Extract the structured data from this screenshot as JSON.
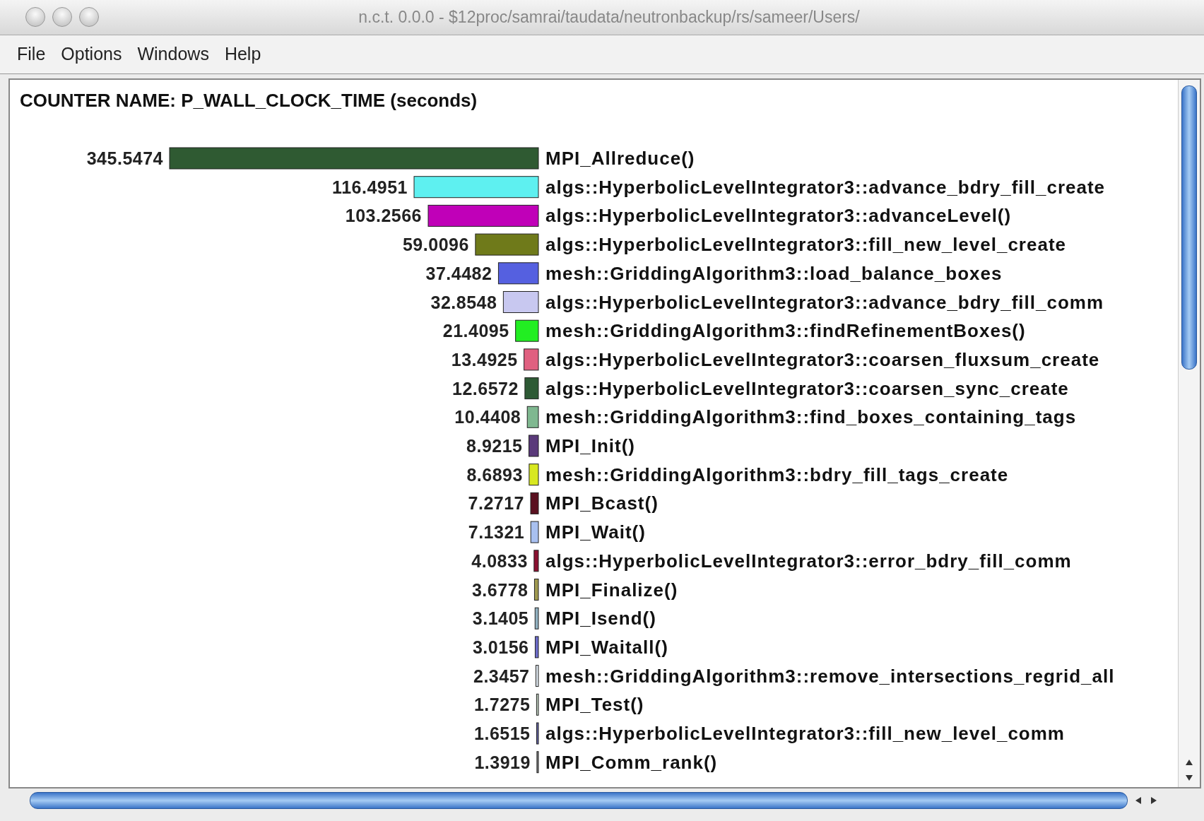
{
  "window": {
    "title": "n.c.t. 0.0.0 - $12proc/samrai/taudata/neutronbackup/rs/sameer/Users/"
  },
  "menu": [
    "File",
    "Options",
    "Windows",
    "Help"
  ],
  "chart": {
    "chart_data": {
      "type": "bar",
      "orientation": "horizontal",
      "title": "COUNTER NAME: P_WALL_CLOCK_TIME (seconds)",
      "data_labels": true,
      "categories": [
        "MPI_Allreduce()",
        "algs::HyperbolicLevelIntegrator3::advance_bdry_fill_create",
        "algs::HyperbolicLevelIntegrator3::advanceLevel()",
        "algs::HyperbolicLevelIntegrator3::fill_new_level_create",
        "mesh::GriddingAlgorithm3::load_balance_boxes",
        "algs::HyperbolicLevelIntegrator3::advance_bdry_fill_comm",
        "mesh::GriddingAlgorithm3::findRefinementBoxes()",
        "algs::HyperbolicLevelIntegrator3::coarsen_fluxsum_create",
        "algs::HyperbolicLevelIntegrator3::coarsen_sync_create",
        "mesh::GriddingAlgorithm3::find_boxes_containing_tags",
        "MPI_Init()",
        "mesh::GriddingAlgorithm3::bdry_fill_tags_create",
        "MPI_Bcast()",
        "MPI_Wait()",
        "algs::HyperbolicLevelIntegrator3::error_bdry_fill_comm",
        "MPI_Finalize()",
        "MPI_Isend()",
        "MPI_Waitall()",
        "mesh::GriddingAlgorithm3::remove_intersections_regrid_all",
        "MPI_Test()",
        "algs::HyperbolicLevelIntegrator3::fill_new_level_comm",
        "MPI_Comm_rank()"
      ],
      "value_labels": [
        "345.5474",
        "116.4951",
        "103.2566",
        "59.0096",
        "37.4482",
        "32.8548",
        "21.4095",
        "13.4925",
        "12.6572",
        "10.4408",
        "8.9215",
        "8.6893",
        "7.2717",
        "7.1321",
        "4.0833",
        "3.6778",
        "3.1405",
        "3.0156",
        "2.3457",
        "1.7275",
        "1.6515",
        "1.3919"
      ],
      "colors": [
        "#2f5a32",
        "#5ef0f0",
        "#c000b8",
        "#6f7a1a",
        "#5560e0",
        "#c8c8f0",
        "#22ee22",
        "#e06080",
        "#2e5a35",
        "#7fb890",
        "#5a3a7a",
        "#d8e820",
        "#5a1020",
        "#a8c0f0",
        "#8a1030",
        "#a09a50",
        "#90b0c0",
        "#6a6ac8",
        "#e0e8f0",
        "#c0d0c0",
        "#6060a0",
        "#808080"
      ],
      "series": [
        {
          "values": [
            345.5474,
            116.4951,
            103.2566,
            59.0096,
            37.4482,
            32.8548,
            21.4095,
            13.4925,
            12.6572,
            10.4408,
            8.9215,
            8.6893,
            7.2717,
            7.1321,
            4.0833,
            3.6778,
            3.1405,
            3.0156,
            2.3457,
            1.7275,
            1.6515,
            1.3919
          ]
        }
      ]
    }
  }
}
